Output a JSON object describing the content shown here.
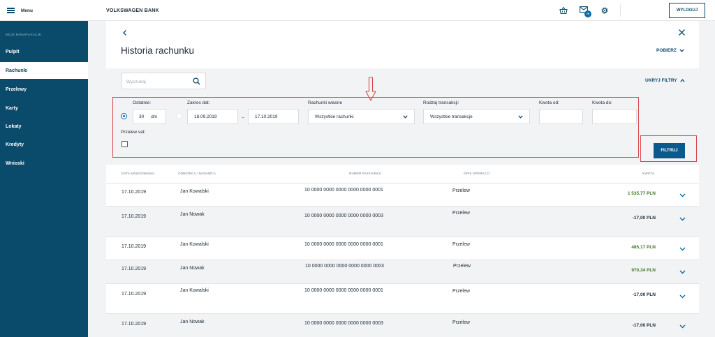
{
  "menu": {
    "label": "Menu"
  },
  "bank_name": "VOLKSWAGEN BANK",
  "header": {
    "mail_badge": "76",
    "logout_label": "WYLOGUJ"
  },
  "sidebar": {
    "section": "MOJE MINIAPLIKACJE",
    "items": [
      {
        "label": "Pulpit"
      },
      {
        "label": "Rachunki"
      },
      {
        "label": "Przelewy"
      },
      {
        "label": "Karty"
      },
      {
        "label": "Lokaty"
      },
      {
        "label": "Kredyty"
      },
      {
        "label": "Wnioski"
      }
    ]
  },
  "page": {
    "title": "Historia rachunku",
    "download_label": "POBIERZ"
  },
  "search": {
    "placeholder": "Wyszukaj"
  },
  "filters": {
    "hide_label": "UKRYJ FILTRY",
    "last_label": "Ostatnie:",
    "last_value": "30",
    "last_unit": "dni",
    "range_label": "Zakres dat:",
    "date_from": "18.09.2019",
    "date_sep": "–",
    "date_to": "17.10.2019",
    "accounts_label": "Rachunki własne",
    "accounts_value": "Wszystkie rachunki",
    "type_label": "Rodzaj transakcji:",
    "type_value": "Wszystkie transakcje",
    "amount_from_label": "Kwota od:",
    "amount_to_label": "Kwota do:",
    "vat_label": "Przelew vat:",
    "filter_button": "FILTRUJ"
  },
  "table": {
    "headers": {
      "date": "DATA KSIĘGOWANIA",
      "party": "ODBIORCA / NADAWCA",
      "account": "NUMER RACHUNKU",
      "desc": "OPIS OPERACJI",
      "amount": "KWOTA"
    },
    "rows": [
      {
        "date": "17.10.2019",
        "party": "Jan Kowalski",
        "account": "10 0000 0000 0000 0000 0000 0001",
        "desc": "Przelew",
        "amount": "1 535,77 PLN",
        "positive": true
      },
      {
        "date": "17.10.2019",
        "party": "Jan Nowak",
        "account": "10 0000 0000 0000 0000 0000 0003",
        "desc": "Przelew",
        "amount": "-17,00 PLN",
        "positive": false
      },
      {
        "date": "17.10.2019",
        "party": "Jan Kowalski",
        "account": "10 0000 0000 0000 0000 0000 0001",
        "desc": "Przelew",
        "amount": "485,17 PLN",
        "positive": true
      },
      {
        "date": "17.10.2019",
        "party": "Jan Nowak",
        "account": "10 0000 0000 0000 0000 0000 0003",
        "desc": "Przelew",
        "amount": "970,34 PLN",
        "positive": true
      },
      {
        "date": "17.10.2019",
        "party": "Jan Kowalski",
        "account": "10 0000 0000 0000 0000 0000 0001",
        "desc": "Przelew",
        "amount": "-17,00 PLN",
        "positive": false
      },
      {
        "date": "17.10.2019",
        "party": "Jan Nowak",
        "account": "10 0000 0000 0000 0000 0000 0003",
        "desc": "Przelew",
        "amount": "-17,00 PLN",
        "positive": false
      }
    ]
  },
  "colors": {
    "sidebar_bg": "#0a4a6b",
    "accent": "#0a5a8e",
    "positive_amount": "#3d7a25",
    "annotation_red": "#d6484d"
  }
}
